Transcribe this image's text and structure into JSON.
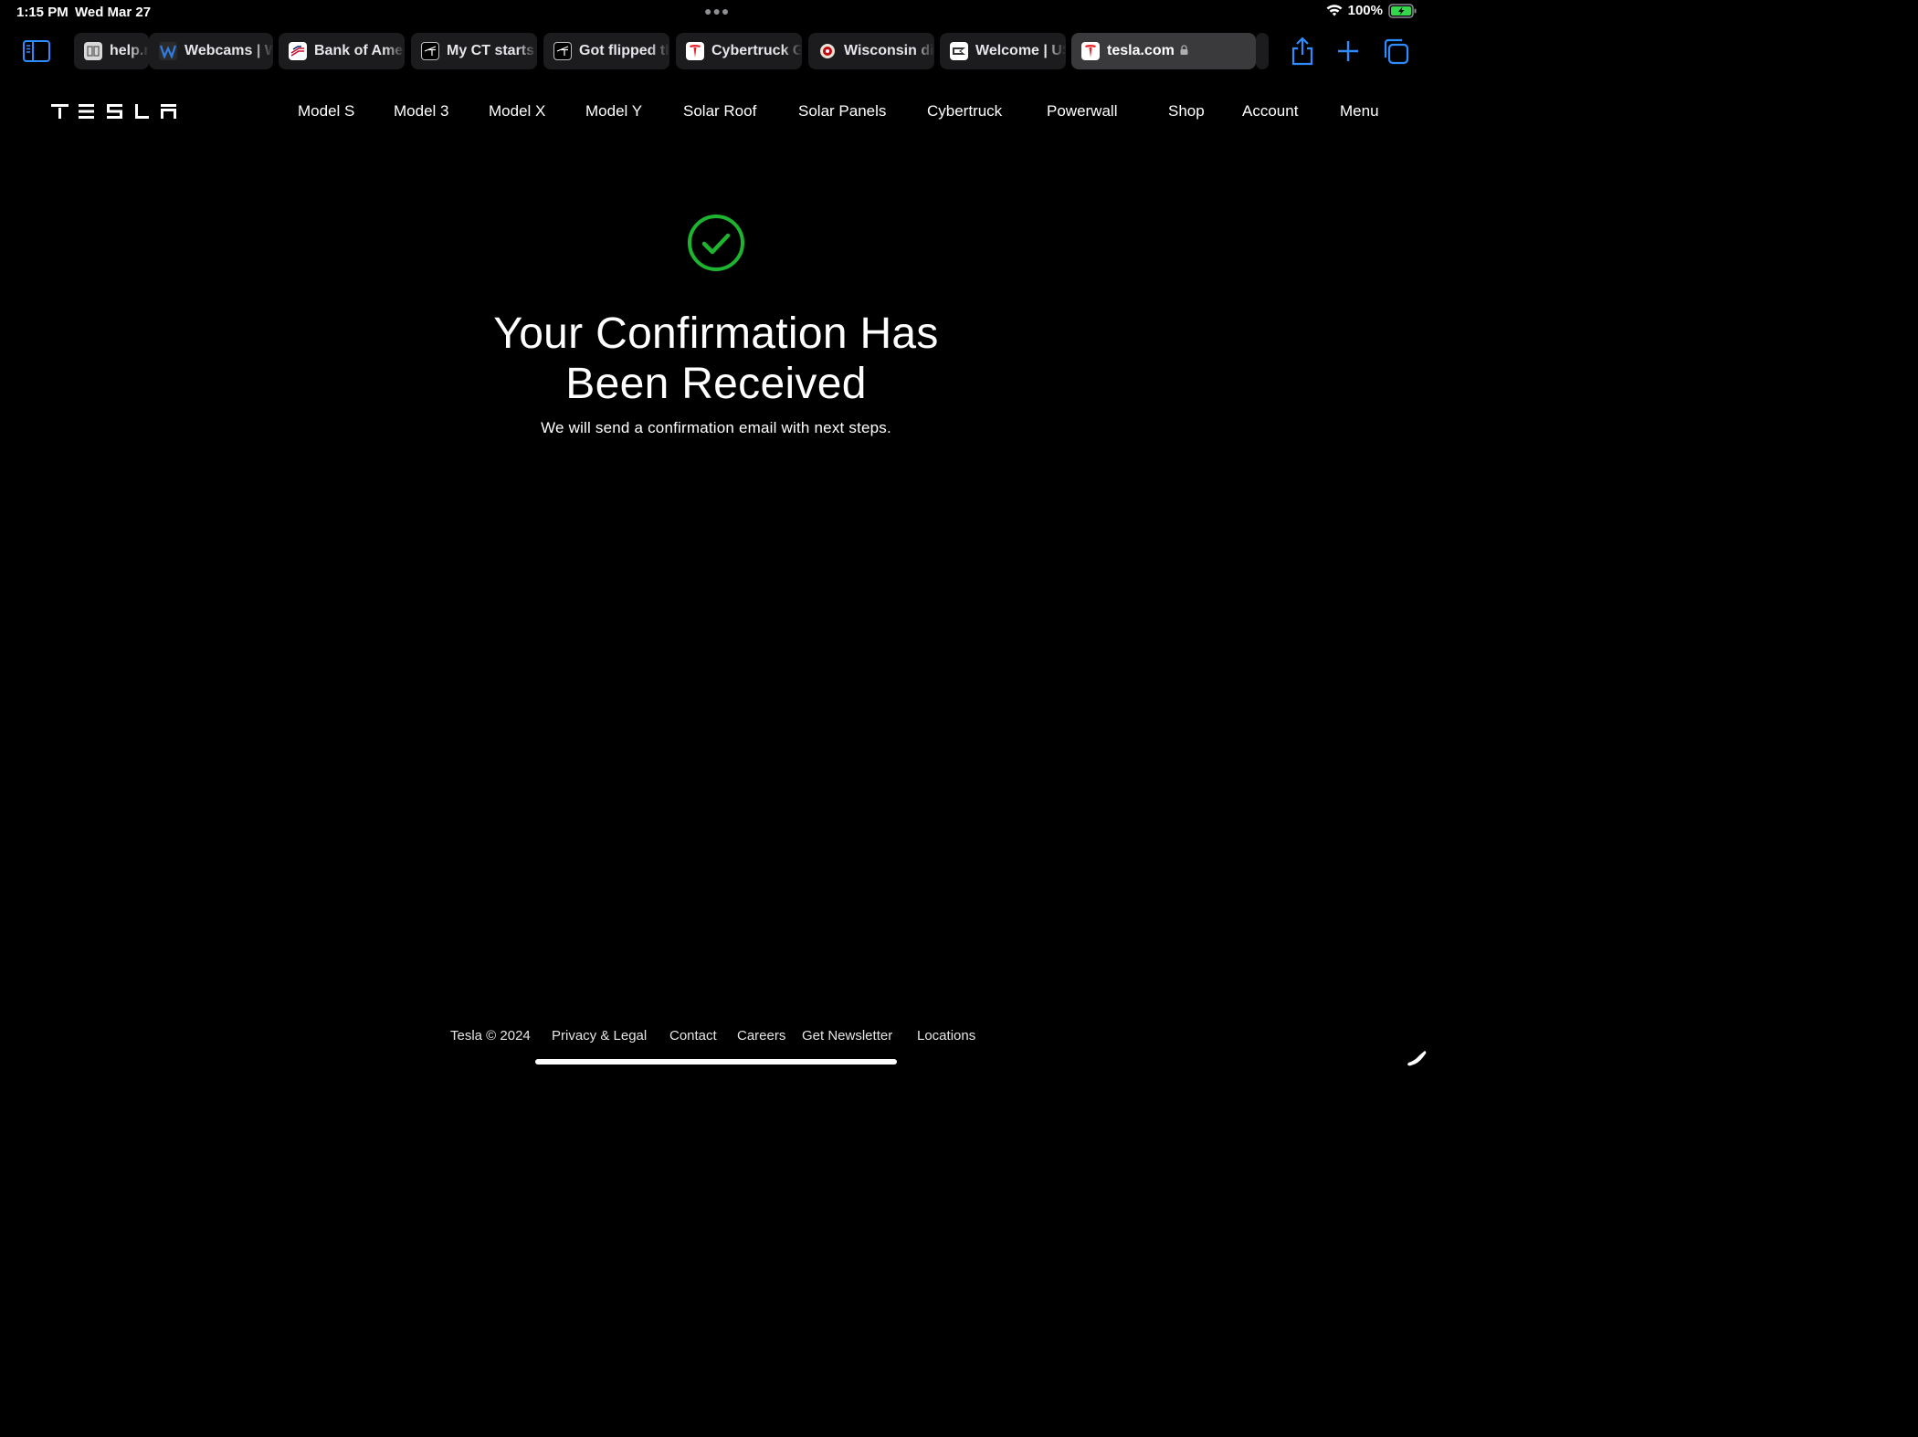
{
  "status_bar": {
    "time": "1:15 PM",
    "date": "Wed Mar 27",
    "battery": "100%"
  },
  "tabs": [
    {
      "label": "help.r",
      "icon": "reader-icon",
      "active": false
    },
    {
      "label": "Webcams | W",
      "icon": "w-logo-icon",
      "active": false
    },
    {
      "label": "Bank of Amer",
      "icon": "bank-flag-icon",
      "active": false
    },
    {
      "label": "My CT starts",
      "icon": "forum-icon",
      "active": false
    },
    {
      "label": "Got flipped tl",
      "icon": "forum-icon",
      "active": false
    },
    {
      "label": "Cybertruck G",
      "icon": "tesla-t-icon",
      "active": false
    },
    {
      "label": "Wisconsin di",
      "icon": "badger-icon",
      "active": false
    },
    {
      "label": "Welcome | US",
      "icon": "usps-eagle-icon",
      "active": false
    },
    {
      "label": "tesla.com",
      "icon": "tesla-t-icon",
      "active": true
    }
  ],
  "site": {
    "logo_text": "TESLA",
    "nav": [
      "Model S",
      "Model 3",
      "Model X",
      "Model Y",
      "Solar Roof",
      "Solar Panels",
      "Cybertruck",
      "Powerwall",
      "Shop",
      "Account",
      "Menu"
    ]
  },
  "content": {
    "headline_line1": "Your Confirmation Has",
    "headline_line2": "Been Received",
    "subtext": "We will send a confirmation email with next steps."
  },
  "footer": [
    "Tesla © 2024",
    "Privacy & Legal",
    "Contact",
    "Careers",
    "Get Newsletter",
    "Locations"
  ],
  "colors": {
    "accent_blue": "#2f8cff",
    "success_green": "#1db52f",
    "tesla_red": "#e82127"
  }
}
